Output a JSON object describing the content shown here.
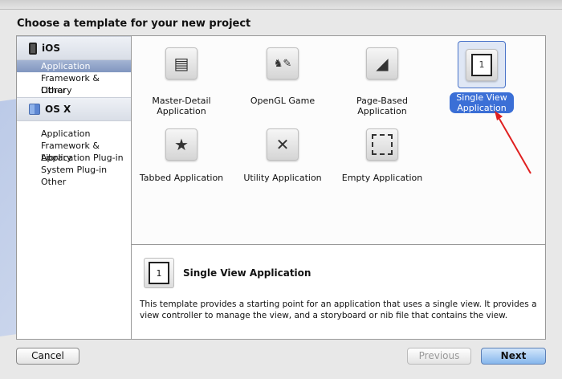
{
  "window": {
    "title": "Choose a template for your new project"
  },
  "sidebar": {
    "sections": [
      {
        "label": "iOS",
        "icon": "iphone-icon",
        "items": [
          "Application",
          "Framework & Library",
          "Other"
        ],
        "selected": 0
      },
      {
        "label": "OS X",
        "icon": "finder-icon",
        "items": [
          "Application",
          "Framework & Library",
          "Application Plug-in",
          "System Plug-in",
          "Other"
        ]
      }
    ]
  },
  "templates": [
    {
      "label1": "Master-Detail",
      "label2": "Application",
      "icon": "master-detail-icon"
    },
    {
      "label1": "OpenGL Game",
      "label2": "",
      "icon": "opengl-game-icon"
    },
    {
      "label1": "Page-Based",
      "label2": "Application",
      "icon": "page-based-icon"
    },
    {
      "label1": "Single View",
      "label2": "Application",
      "icon": "single-view-icon",
      "glyph": "1",
      "selected": true
    },
    {
      "label1": "Tabbed Application",
      "icon": "tabbed-icon"
    },
    {
      "label1": "Utility Application",
      "icon": "utility-icon"
    },
    {
      "label1": "Empty Application",
      "icon": "empty-icon"
    }
  ],
  "description": {
    "glyph": "1",
    "title": "Single View Application",
    "text": "This template provides a starting point for an application that uses a single view. It provides a view controller to manage the view, and a storyboard or nib file that contains the view."
  },
  "buttons": {
    "cancel": "Cancel",
    "previous": "Previous",
    "next": "Next"
  },
  "colors": {
    "selection": "#3b6fd6",
    "annotation_arrow": "#e02020"
  }
}
